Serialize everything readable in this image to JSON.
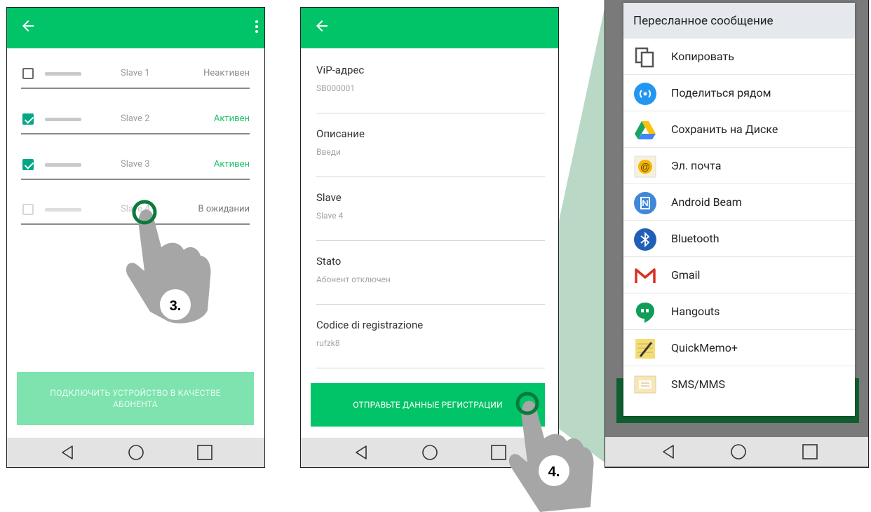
{
  "screen1": {
    "rows": [
      {
        "slave": "Slave 1",
        "status": "Неактивен",
        "checked": false
      },
      {
        "slave": "Slave 2",
        "status": "Активен",
        "checked": true
      },
      {
        "slave": "Slave 3",
        "status": "Активен",
        "checked": true
      },
      {
        "slave": "Slave 4",
        "status": "В ожидании",
        "checked": false
      }
    ],
    "connect_button": "ПОДКЛЮЧИТЬ УСТРОЙСТВО В КАЧЕСТВЕ АБОНЕНТА",
    "step_label": "3."
  },
  "screen2": {
    "fields": [
      {
        "label": "ViP-адрес",
        "value": "SB000001"
      },
      {
        "label": "Описание",
        "value": "Введи"
      },
      {
        "label": "Slave",
        "value": "Slave 4"
      },
      {
        "label": "Stato",
        "value": "Абонент отключен"
      },
      {
        "label": "Codice di registrazione",
        "value": "rufzk8"
      }
    ],
    "send_button": "ОТПРАВЬТЕ ДАННЫЕ РЕГИСТРАЦИИ",
    "step_label": "4."
  },
  "screen3": {
    "title": "Пересланное сообщение",
    "items": [
      {
        "label": "Копировать",
        "icon": "copy-icon"
      },
      {
        "label": "Поделиться рядом",
        "icon": "nearby-share-icon"
      },
      {
        "label": "Сохранить на Диске",
        "icon": "google-drive-icon"
      },
      {
        "label": "Эл. почта",
        "icon": "email-icon"
      },
      {
        "label": "Android Beam",
        "icon": "android-beam-icon"
      },
      {
        "label": "Bluetooth",
        "icon": "bluetooth-icon"
      },
      {
        "label": "Gmail",
        "icon": "gmail-icon"
      },
      {
        "label": "Hangouts",
        "icon": "hangouts-icon"
      },
      {
        "label": "QuickMemo+",
        "icon": "quickmemo-icon"
      },
      {
        "label": "SMS/MMS",
        "icon": "sms-icon"
      }
    ]
  },
  "colors": {
    "app_bar": "#00c467",
    "active_status": "#1fbf6a",
    "disabled_button": "#7ee3ae",
    "hand": "#a6a6a6",
    "tap_ring": "#0a7a3c",
    "connector": "#b9d8c5"
  }
}
